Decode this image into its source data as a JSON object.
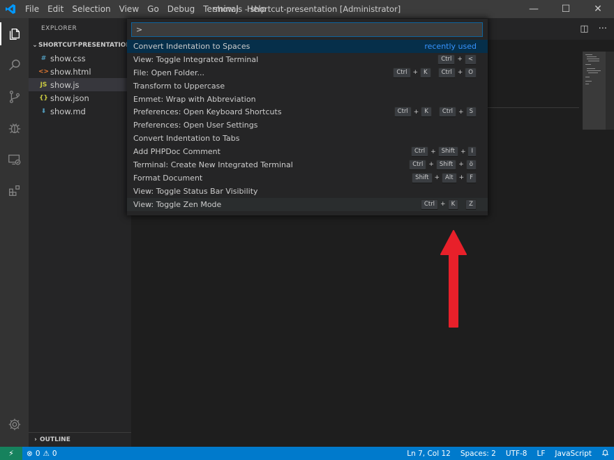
{
  "window": {
    "title": "show.js - shortcut-presentation [Administrator]",
    "menu": [
      "File",
      "Edit",
      "Selection",
      "View",
      "Go",
      "Debug",
      "Terminal",
      "Help"
    ],
    "controls": [
      "—",
      "☐",
      "✕"
    ]
  },
  "activity_bar": {
    "items": [
      "explorer-icon",
      "search-icon",
      "source-control-icon",
      "debug-icon",
      "remote-explorer-icon",
      "extensions-icon"
    ],
    "bottom": "gear-icon"
  },
  "sidebar": {
    "title": "EXPLORER",
    "folder": "SHORTCUT-PRESENTATION",
    "files": [
      {
        "icon": "#",
        "name": "show.css",
        "color": "#519aba"
      },
      {
        "icon": "<>",
        "name": "show.html",
        "color": "#e37933"
      },
      {
        "icon": "JS",
        "name": "show.js",
        "color": "#cbcb41"
      },
      {
        "icon": "{}",
        "name": "show.json",
        "color": "#cbcb41"
      },
      {
        "icon": "⬇",
        "name": "show.md",
        "color": "#519aba"
      }
    ],
    "outline": "OUTLINE"
  },
  "quick_open": {
    "input_value": ">",
    "items": [
      {
        "label": "Convert Indentation to Spaces",
        "recent": "recently used"
      },
      {
        "label": "View: Toggle Integrated Terminal",
        "keys": [
          [
            "Ctrl",
            "<"
          ]
        ]
      },
      {
        "label": "File: Open Folder...",
        "keys": [
          [
            "Ctrl",
            "K"
          ],
          [
            "Ctrl",
            "O"
          ]
        ]
      },
      {
        "label": "Transform to Uppercase"
      },
      {
        "label": "Emmet: Wrap with Abbreviation"
      },
      {
        "label": "Preferences: Open Keyboard Shortcuts",
        "keys": [
          [
            "Ctrl",
            "K"
          ],
          [
            "Ctrl",
            "S"
          ]
        ]
      },
      {
        "label": "Preferences: Open User Settings"
      },
      {
        "label": "Convert Indentation to Tabs"
      },
      {
        "label": "Add PHPDoc Comment",
        "keys": [
          [
            "Ctrl",
            "Shift",
            "I"
          ]
        ]
      },
      {
        "label": "Terminal: Create New Integrated Terminal",
        "keys": [
          [
            "Ctrl",
            "Shift",
            "ö"
          ]
        ]
      },
      {
        "label": "Format Document",
        "keys": [
          [
            "Shift",
            "Alt",
            "F"
          ]
        ]
      },
      {
        "label": "View: Toggle Status Bar Visibility"
      },
      {
        "label": "View: Toggle Zen Mode",
        "keys": [
          [
            "Ctrl",
            "K"
          ],
          [
            "Z"
          ]
        ]
      }
    ]
  },
  "editor_actions": {
    "split": "◫",
    "more": "···"
  },
  "status_bar": {
    "remote_icon": "⚡",
    "errors": "0",
    "warnings": "0",
    "position": "Ln 7, Col 12",
    "spaces": "Spaces: 2",
    "encoding": "UTF-8",
    "eol": "LF",
    "language": "JavaScript",
    "bell": "🔔"
  },
  "colors": {
    "accent": "#007acc",
    "arrow": "#e8202a",
    "focus_row": "#062f4a"
  }
}
